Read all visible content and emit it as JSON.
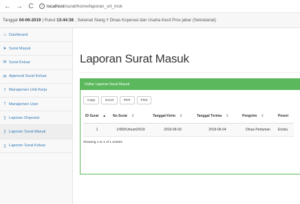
{
  "browser": {
    "back_icon": "←",
    "forward_icon": "→",
    "reload_icon": "C",
    "info_icon": "i",
    "host": "localhost",
    "path": "/surat/home/laporan_srt_msk"
  },
  "top_info": {
    "prefix": "Tanggal",
    "date": "04-06-2019",
    "mid": "| Pukul",
    "time": "13:44:38",
    "suffix": ", Selamat Siang !! Dinas Koperasi dan Usaha Kecil Prov jabar (Sekretariat)"
  },
  "sidebar": {
    "items": [
      {
        "label": "Dashboard",
        "icon": "dashboard-icon",
        "glyph": "⌂"
      },
      {
        "label": "Surat Masuk",
        "icon": "send-icon",
        "glyph": "➤"
      },
      {
        "label": "Surat Keluar",
        "icon": "envelope-icon",
        "glyph": "✉"
      },
      {
        "label": "Approval Surat Keluar",
        "icon": "envelope-icon",
        "glyph": "✉"
      },
      {
        "label": "Manajemen Unit Kerja",
        "icon": "pin-icon",
        "glyph": "⇡"
      },
      {
        "label": "Manajemen User",
        "icon": "pin-icon",
        "glyph": "⇡"
      },
      {
        "label": "Laporan Disposisi",
        "icon": "file-icon",
        "glyph": "▯"
      },
      {
        "label": "Laporan Surat Masuk",
        "icon": "file-icon",
        "glyph": "▯"
      },
      {
        "label": "Laporan Surat Keluar",
        "icon": "file-icon",
        "glyph": "▯"
      }
    ]
  },
  "main": {
    "title": "Laporan Surat Masuk",
    "panel_title": "Daftar Laporan Surat Masuk",
    "buttons": [
      "Copy",
      "Excel",
      "PDF",
      "Print"
    ],
    "columns": [
      "ID Surat",
      "No Surat",
      "Tanggal Kirim",
      "Tanggal Terima",
      "Pengirim",
      "Peneri"
    ],
    "rows": [
      [
        "1",
        "1/000/Umum/2019",
        "2019-06-03",
        "2019-06-04",
        "Dinas Pertanian",
        "Erizka"
      ]
    ],
    "info": "Showing 1 to 1 of 1 entries"
  },
  "colors": {
    "panel_green": "#5cb85c",
    "link_blue": "#337ab7"
  }
}
